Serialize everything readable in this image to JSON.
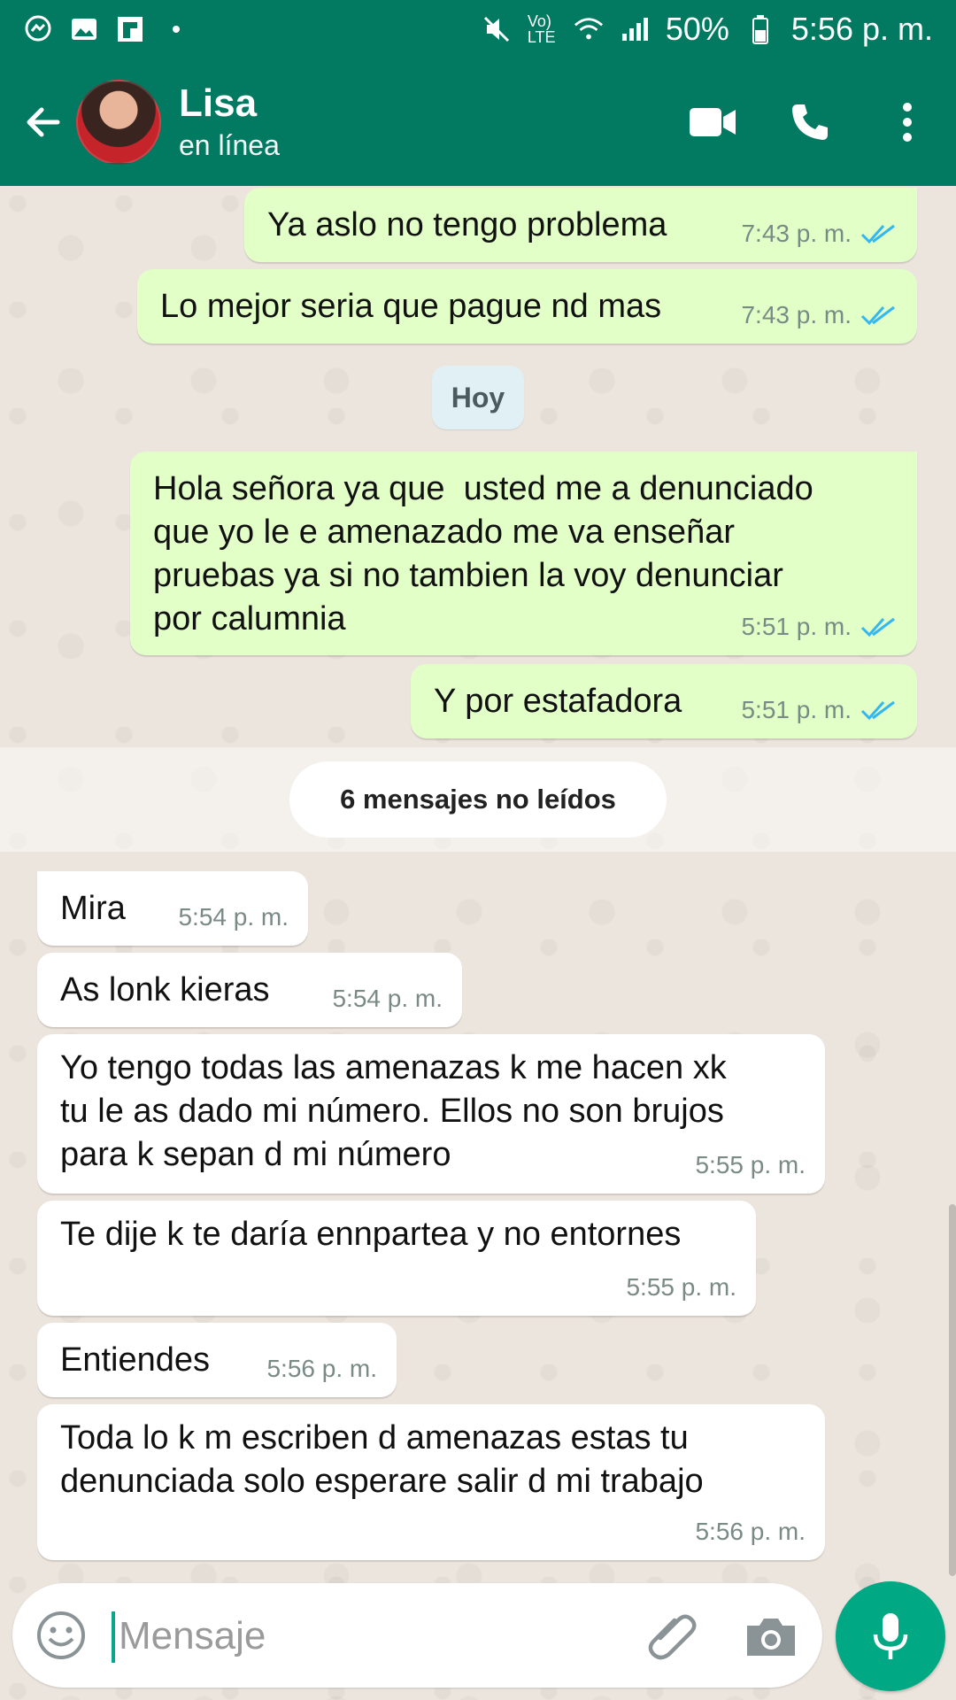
{
  "status_bar": {
    "battery": "50%",
    "time": "5:56 p. m.",
    "network_label": "Vo) LTE"
  },
  "header": {
    "contact_name": "Lisa",
    "contact_status": "en línea",
    "icons": [
      "back-arrow-icon",
      "video-call-icon",
      "phone-icon",
      "more-vert-icon"
    ]
  },
  "conversation": {
    "day_label": "Hoy",
    "unread_label": "6 mensajes no leídos",
    "messages": [
      {
        "text": "Ya aslo no tengo problema",
        "time": "7:43 p. m.",
        "dir": "out"
      },
      {
        "text": "Lo mejor seria que pague nd mas",
        "time": "7:43 p. m.",
        "dir": "out"
      },
      {
        "text": "Hola señora ya que  usted me a denunciado\nque yo le e amenazado me va enseñar\npruebas ya si no tambien la voy denunciar\npor calumnia",
        "time": "5:51 p. m.",
        "dir": "out"
      },
      {
        "text": "Y por estafadora",
        "time": "5:51 p. m.",
        "dir": "out"
      },
      {
        "text": "Mira",
        "time": "5:54 p. m.",
        "dir": "in"
      },
      {
        "text": "As lonk kieras",
        "time": "5:54 p. m.",
        "dir": "in"
      },
      {
        "text": "Yo tengo todas las amenazas k me hacen xk\ntu le as dado mi número. Ellos no son brujos\npara k sepan d mi número",
        "time": "5:55 p. m.",
        "dir": "in"
      },
      {
        "text": "Te dije k te daría ennpartea y no entornes",
        "time": "5:55 p. m.",
        "dir": "in"
      },
      {
        "text": "Entiendes",
        "time": "5:56 p. m.",
        "dir": "in"
      },
      {
        "text": "Toda lo k m escriben d amenazas estas tu\ndenunciada solo esperare salir d mi trabajo",
        "time": "5:56 p. m.",
        "dir": "in"
      }
    ]
  },
  "composer": {
    "placeholder": "Mensaje"
  },
  "colors": {
    "header": "#017a61",
    "outgoing_bubble": "#e1ffc7",
    "incoming_bubble": "#ffffff",
    "read_ticks": "#34b7f1",
    "mic_button": "#00a884"
  }
}
